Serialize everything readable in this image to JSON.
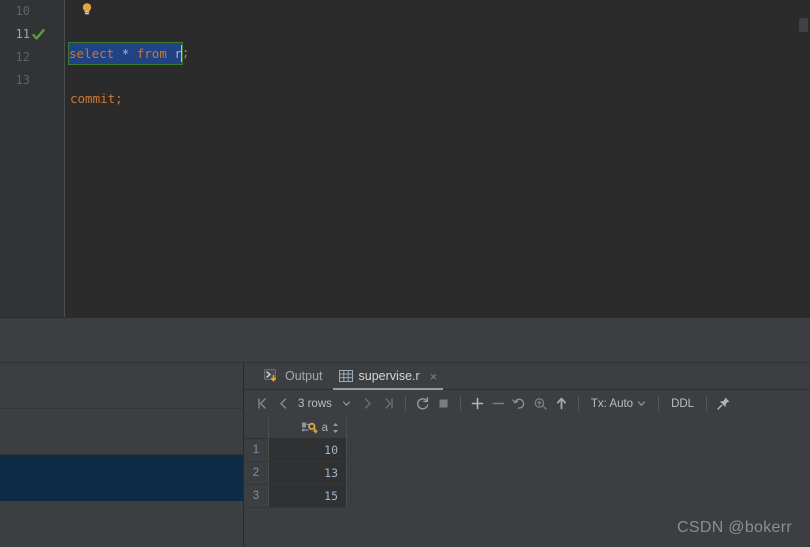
{
  "editor": {
    "lines": [
      {
        "number": "10",
        "icon": "none",
        "current": false,
        "content": ""
      },
      {
        "number": "11",
        "icon": "check-mark-icon",
        "current": true,
        "content": "select * from r;"
      },
      {
        "number": "12",
        "icon": "none",
        "current": false,
        "content": ""
      },
      {
        "number": "13",
        "icon": "none",
        "current": false,
        "content": "commit;"
      }
    ],
    "selected_statement": "select * from r",
    "tokens": {
      "kw_select": "select",
      "op_star": "*",
      "kw_from": "from",
      "table": "r",
      "semicolon": ";",
      "commit": "commit",
      "commit_semicolon": ";"
    },
    "intention_bulb": "lightbulb-icon",
    "colors": {
      "background": "#2b2b2b",
      "gutter": "#313335",
      "keyword": "#cc7832",
      "identifier": "#a9b7c6",
      "selection": "#214283",
      "statement_border": "#3a7a2e",
      "checkmark": "#5a9e3a"
    }
  },
  "left_panel": {
    "selected_row_color": "#0d2b45",
    "rows": [
      {
        "selected": false
      },
      {
        "selected": false
      },
      {
        "selected": false
      },
      {
        "selected": true
      },
      {
        "selected": false
      }
    ]
  },
  "results": {
    "tabs": [
      {
        "label": "Output",
        "icon": "console-output-icon",
        "active": false,
        "closable": false
      },
      {
        "label": "supervise.r",
        "icon": "table-grid-icon",
        "active": true,
        "closable": true,
        "close_label": "×"
      }
    ],
    "toolbar": {
      "first_page": "⏪",
      "prev_page": "‹",
      "rows_count": "3 rows",
      "rows_chevron": "⌄",
      "next_page": "›",
      "last_page": "⏩",
      "reload": "refresh-icon",
      "stop": "stop-icon",
      "add_row": "+",
      "delete_row": "−",
      "revert": "↶",
      "revert_selected": "revert-selected-icon",
      "submit": "↑",
      "tx_label": "Tx: Auto",
      "tx_chevron": "⌄",
      "ddl_label": "DDL",
      "pin_label": "pin-tab-icon"
    },
    "grid": {
      "columns": [
        {
          "name": "a",
          "key_icon": "primary-key-icon",
          "sort_icon": "sort-indicator-icon"
        }
      ],
      "rows": [
        {
          "num": "1",
          "a": "10"
        },
        {
          "num": "2",
          "a": "13"
        },
        {
          "num": "3",
          "a": "15"
        }
      ]
    }
  },
  "watermark": {
    "text": "CSDN @bokerr"
  }
}
